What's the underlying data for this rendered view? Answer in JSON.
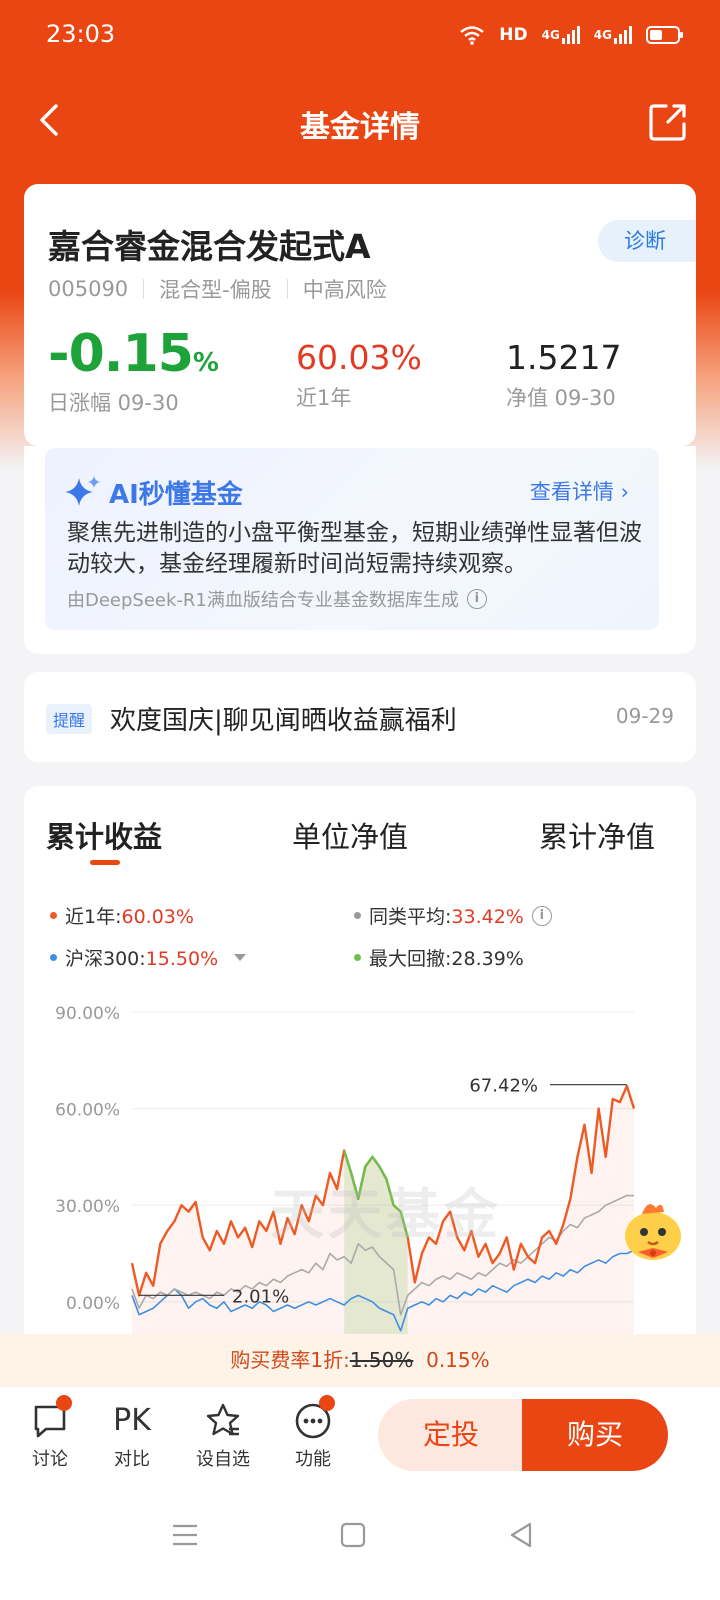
{
  "status_bar": {
    "time": "23:03",
    "signal_labels": [
      "HD",
      "4G",
      "4G"
    ]
  },
  "nav": {
    "title": "基金详情"
  },
  "fund": {
    "name": "嘉合睿金混合发起式A",
    "diagnose": "诊断",
    "code": "005090",
    "type": "混合型-偏股",
    "risk": "中高风险",
    "day_change": "-0.15",
    "day_change_unit": "%",
    "day_change_label": "日涨幅 09-30",
    "year_return": "60.03%",
    "year_label": "近1年",
    "nav_value": "1.5217",
    "nav_label": "净值 09-30"
  },
  "ai": {
    "title": "AI秒懂基金",
    "more": "查看详情",
    "summary": "聚焦先进制造的小盘平衡型基金，短期业绩弹性显著但波动较大，基金经理履新时间尚短需持续观察。",
    "footnote": "由DeepSeek-R1满血版结合专业基金数据库生成"
  },
  "notice": {
    "tag": "提醒",
    "text": "欢度国庆|聊见闻晒收益赢福利",
    "date": "09-29"
  },
  "tabs": [
    "累计收益",
    "单位净值",
    "累计净值"
  ],
  "legend": [
    {
      "label": "近1年:",
      "value": "60.03%",
      "color": "#ee5a24"
    },
    {
      "label": "同类平均:",
      "value": "33.42%",
      "color": "#999999"
    },
    {
      "label": "沪深300:",
      "value": "15.50%",
      "color": "#3f8fe3"
    },
    {
      "label": "最大回撤:",
      "value": "28.39%",
      "color": "#6cc04a"
    }
  ],
  "chart_data": {
    "type": "line",
    "ylim": [
      -10,
      90
    ],
    "y_ticks": [
      "90.00%",
      "60.00%",
      "30.00%",
      "0.00%"
    ],
    "y_tick_values": [
      90,
      60,
      30,
      0
    ],
    "series": [
      {
        "name": "近1年",
        "color": "#ee5a24",
        "values": [
          12,
          2,
          9,
          5,
          18,
          22,
          25,
          30,
          28,
          31,
          20,
          16,
          22,
          18,
          25,
          20,
          23,
          17,
          25,
          22,
          28,
          18,
          26,
          21,
          30,
          25,
          33,
          30,
          40,
          35,
          47,
          40,
          32,
          42,
          45,
          42,
          38,
          30,
          28,
          20,
          6,
          15,
          20,
          18,
          25,
          28,
          20,
          16,
          22,
          14,
          18,
          12,
          15,
          20,
          10,
          18,
          14,
          12,
          20,
          22,
          18,
          24,
          32,
          45,
          55,
          40,
          60,
          45,
          63,
          62,
          67,
          60
        ]
      },
      {
        "name": "同类平均",
        "color": "#aaaaaa",
        "values": [
          4,
          -2,
          2,
          1,
          3,
          2,
          4,
          3,
          2,
          3,
          2,
          1,
          3,
          2,
          4,
          3,
          5,
          4,
          6,
          5,
          7,
          6,
          8,
          9,
          10,
          9,
          12,
          10,
          15,
          13,
          14,
          12,
          18,
          16,
          17,
          14,
          12,
          10,
          -4,
          2,
          4,
          6,
          5,
          7,
          8,
          7,
          9,
          8,
          7,
          9,
          8,
          10,
          12,
          11,
          13,
          12,
          14,
          16,
          18,
          20,
          19,
          22,
          24,
          23,
          26,
          27,
          28,
          30,
          31,
          32,
          33,
          33
        ]
      },
      {
        "name": "沪深300",
        "color": "#3f8fe3",
        "values": [
          2,
          -4,
          -3,
          -2,
          0,
          2,
          4,
          2,
          -2,
          0,
          1,
          -1,
          -2,
          0,
          -3,
          -2,
          -1,
          -2,
          0,
          -1,
          -3,
          -2,
          -1,
          -2,
          -1,
          0,
          -1,
          0,
          1,
          0,
          -1,
          1,
          2,
          1,
          0,
          -2,
          -3,
          -4,
          -9,
          -2,
          -1,
          0,
          -1,
          1,
          0,
          2,
          1,
          3,
          2,
          4,
          3,
          5,
          4,
          3,
          5,
          6,
          7,
          6,
          8,
          7,
          9,
          8,
          10,
          9,
          11,
          12,
          13,
          12,
          14,
          15,
          15,
          16
        ]
      }
    ],
    "drawdown_range": [
      30,
      39
    ],
    "annotations": [
      {
        "text": "67.42%",
        "value": 67.42
      },
      {
        "text": "2.01%",
        "value": 2.01
      }
    ]
  },
  "fee": {
    "prefix": "购买费率1折:",
    "old": "1.50%",
    "new": "0.15%"
  },
  "bottom": {
    "discuss": "讨论",
    "pk_icon": "PK",
    "compare": "对比",
    "watch": "设自选",
    "func": "功能",
    "dingtou": "定投",
    "buy": "购买"
  }
}
